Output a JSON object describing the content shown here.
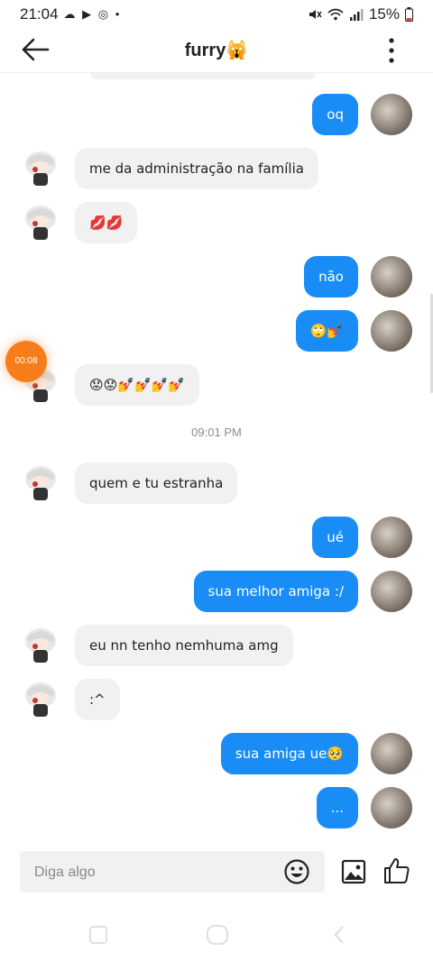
{
  "status_bar": {
    "time": "21:04",
    "notif_icons": "☁ ▶ ◎ •",
    "battery": "15%"
  },
  "header": {
    "title": "furry🙀"
  },
  "messages": [
    {
      "sender": "me",
      "text": "oq"
    },
    {
      "sender": "them",
      "text": "me da administração na família"
    },
    {
      "sender": "them",
      "text": "💋💋"
    },
    {
      "sender": "me",
      "text": "não"
    },
    {
      "sender": "me",
      "text": "🙄💅"
    },
    {
      "sender": "them",
      "text": "😟😟💅💅💅💅"
    },
    {
      "type": "timestamp",
      "text": "09:01 PM"
    },
    {
      "sender": "them",
      "text": "quem e tu estranha"
    },
    {
      "sender": "me",
      "text": "ué"
    },
    {
      "sender": "me",
      "text": "sua melhor amiga :/"
    },
    {
      "sender": "them",
      "text": "eu nn tenho nemhuma amg"
    },
    {
      "sender": "them",
      "text": ":^"
    },
    {
      "sender": "me",
      "text": "sua amiga ue🥺"
    },
    {
      "sender": "me",
      "text": "..."
    }
  ],
  "composer": {
    "placeholder": "Diga algo"
  },
  "recording": {
    "time": "00:08"
  }
}
